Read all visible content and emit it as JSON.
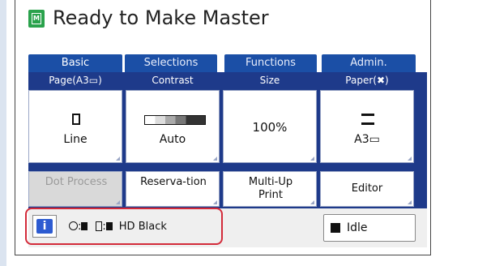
{
  "title": "Ready to Make Master",
  "tabs": [
    {
      "label": "Basic"
    },
    {
      "label": "Selections"
    },
    {
      "label": "Functions"
    },
    {
      "label": "Admin."
    }
  ],
  "settings": {
    "page": {
      "header": "Page(A3▭)",
      "value": "Line"
    },
    "contrast": {
      "header": "Contrast",
      "value": "Auto"
    },
    "size": {
      "header": "Size",
      "value": "100%"
    },
    "paper": {
      "header": "Paper(✖)",
      "value": "A3▭"
    }
  },
  "functions": [
    {
      "label": "Dot Process",
      "enabled": false
    },
    {
      "label": "Reserva-tion",
      "enabled": true
    },
    {
      "label": "Multi-Up Print",
      "enabled": true
    },
    {
      "label": "Editor",
      "enabled": true
    }
  ],
  "status": {
    "ink_label": "HD Black",
    "idle_label": "Idle"
  },
  "colors": {
    "panel": "#1e3a8a",
    "tab": "#1b4fa6",
    "highlight": "#d32b3a",
    "title_icon": "#2aa24c"
  }
}
